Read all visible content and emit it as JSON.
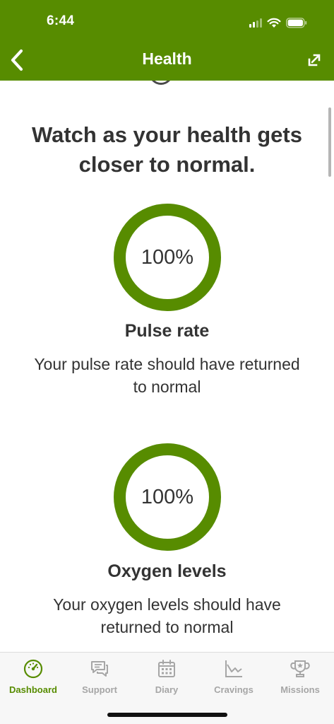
{
  "status_bar": {
    "time": "6:44"
  },
  "nav": {
    "title": "Health"
  },
  "headline": "Watch as your health gets closer to normal.",
  "health_items": [
    {
      "progress_label": "100%",
      "progress": 1.0,
      "title": "Pulse rate",
      "description": "Your pulse rate should have returned to normal"
    },
    {
      "progress_label": "100%",
      "progress": 1.0,
      "title": "Oxygen levels",
      "description": "Your oxygen levels should have returned to normal"
    }
  ],
  "tabs": [
    {
      "label": "Dashboard",
      "icon": "dashboard-gauge-icon",
      "active": true
    },
    {
      "label": "Support",
      "icon": "chat-bubbles-icon",
      "active": false
    },
    {
      "label": "Diary",
      "icon": "calendar-icon",
      "active": false
    },
    {
      "label": "Cravings",
      "icon": "line-chart-icon",
      "active": false
    },
    {
      "label": "Missions",
      "icon": "trophy-icon",
      "active": false
    }
  ],
  "colors": {
    "accent": "#578c00",
    "inactive": "#a6a6a6",
    "text": "#333333"
  }
}
